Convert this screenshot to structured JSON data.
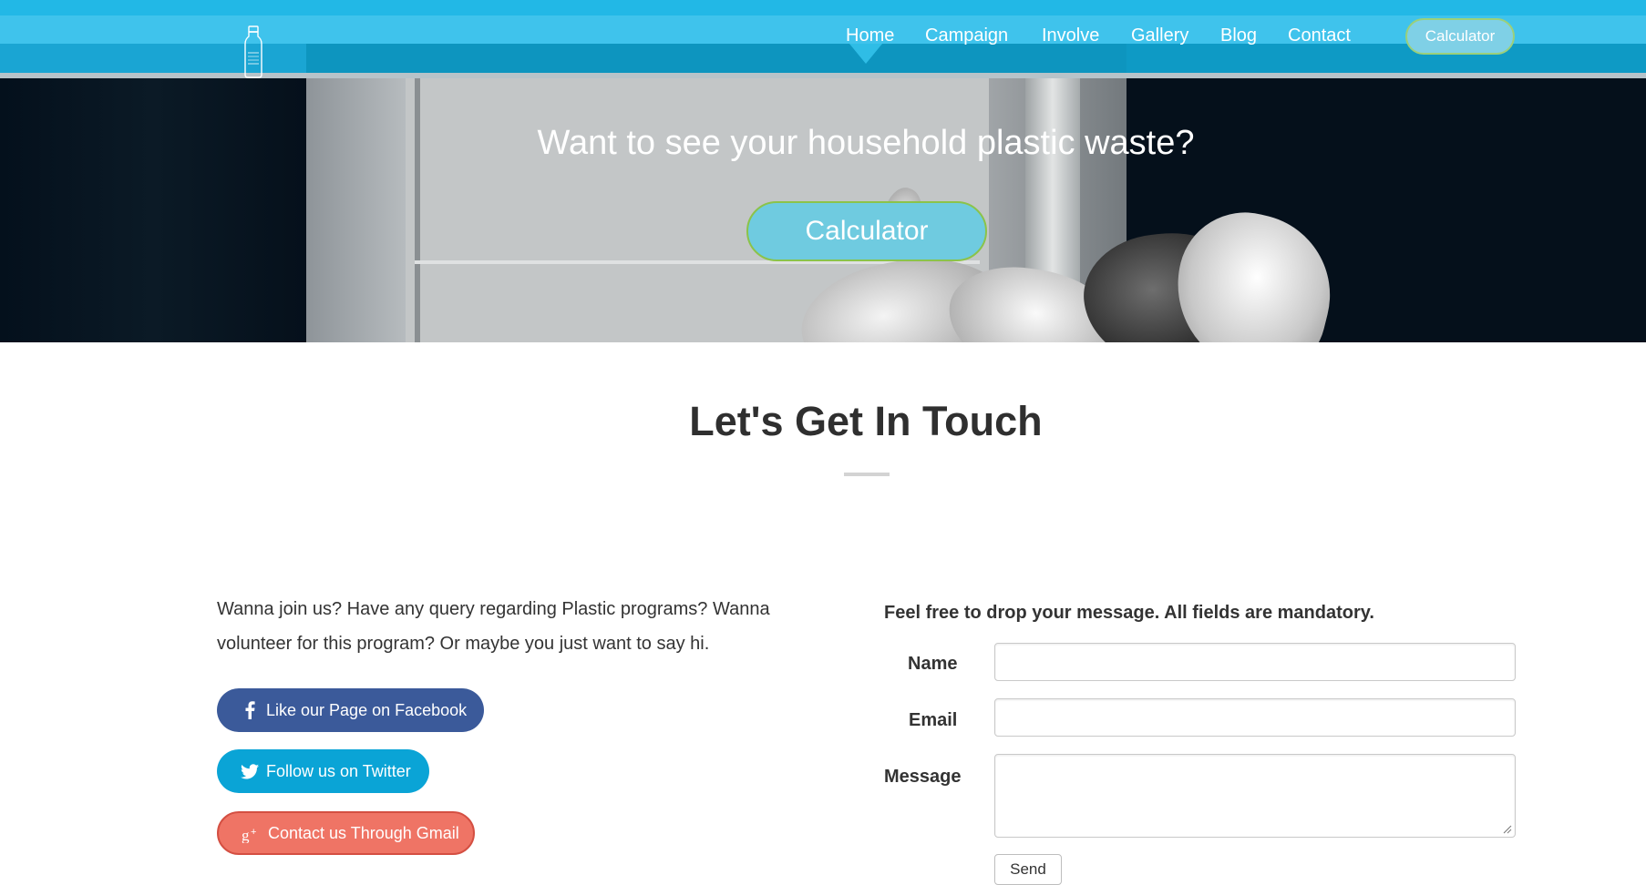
{
  "nav": {
    "logo_icon": "bottle-icon",
    "items": [
      {
        "label": "Home"
      },
      {
        "label": "Campaign"
      },
      {
        "label": "Involve"
      },
      {
        "label": "Gallery"
      },
      {
        "label": "Blog"
      },
      {
        "label": "Contact"
      }
    ],
    "calculator_label": "Calculator"
  },
  "hero": {
    "title": "Want to see your household plastic waste?",
    "button_label": "Calculator"
  },
  "contact": {
    "title": "Let's Get In Touch",
    "intro": "Wanna join us? Have any query regarding Plastic programs? Wanna volunteer for this program? Or maybe you just want to say hi.",
    "social": {
      "facebook_label": "Like our Page on Facebook",
      "facebook_icon": "facebook-icon",
      "twitter_label": "Follow us on Twitter",
      "twitter_icon": "twitter-icon",
      "gmail_label": "Contact us Through Gmail",
      "gmail_icon": "google-plus-icon"
    },
    "form": {
      "note": "Feel free to drop your message. All fields are mandatory.",
      "name_label": "Name",
      "name_value": "",
      "email_label": "Email",
      "email_value": "",
      "message_label": "Message",
      "message_value": "",
      "send_label": "Send"
    }
  },
  "colors": {
    "nav_blue": "#3fc3ec",
    "facebook": "#3b5a9a",
    "twitter": "#0aa4d6",
    "gmail": "#ef7465",
    "calculator_fill": "#6fcbe0",
    "calculator_border": "#8bc34a"
  }
}
